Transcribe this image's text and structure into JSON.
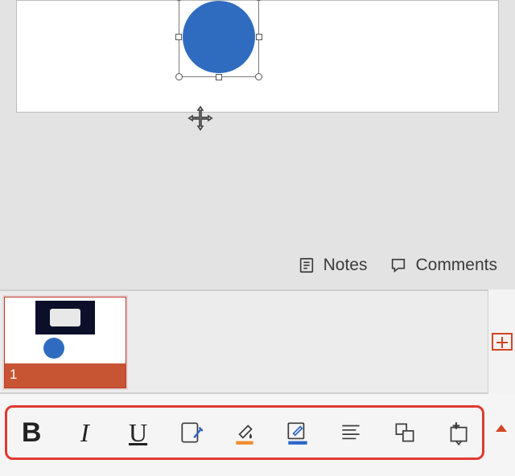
{
  "canvas": {
    "shape": {
      "type": "circle",
      "fill": "#2f6cc0",
      "selected": true
    }
  },
  "meta": {
    "notes_label": "Notes",
    "comments_label": "Comments"
  },
  "thumbnails": {
    "items": [
      {
        "index": "1"
      }
    ]
  },
  "toolbar": {
    "bold": "B",
    "italic": "I",
    "underline": "U",
    "highlight_color": "#f08c2e",
    "font_color": "#2a66c8"
  }
}
